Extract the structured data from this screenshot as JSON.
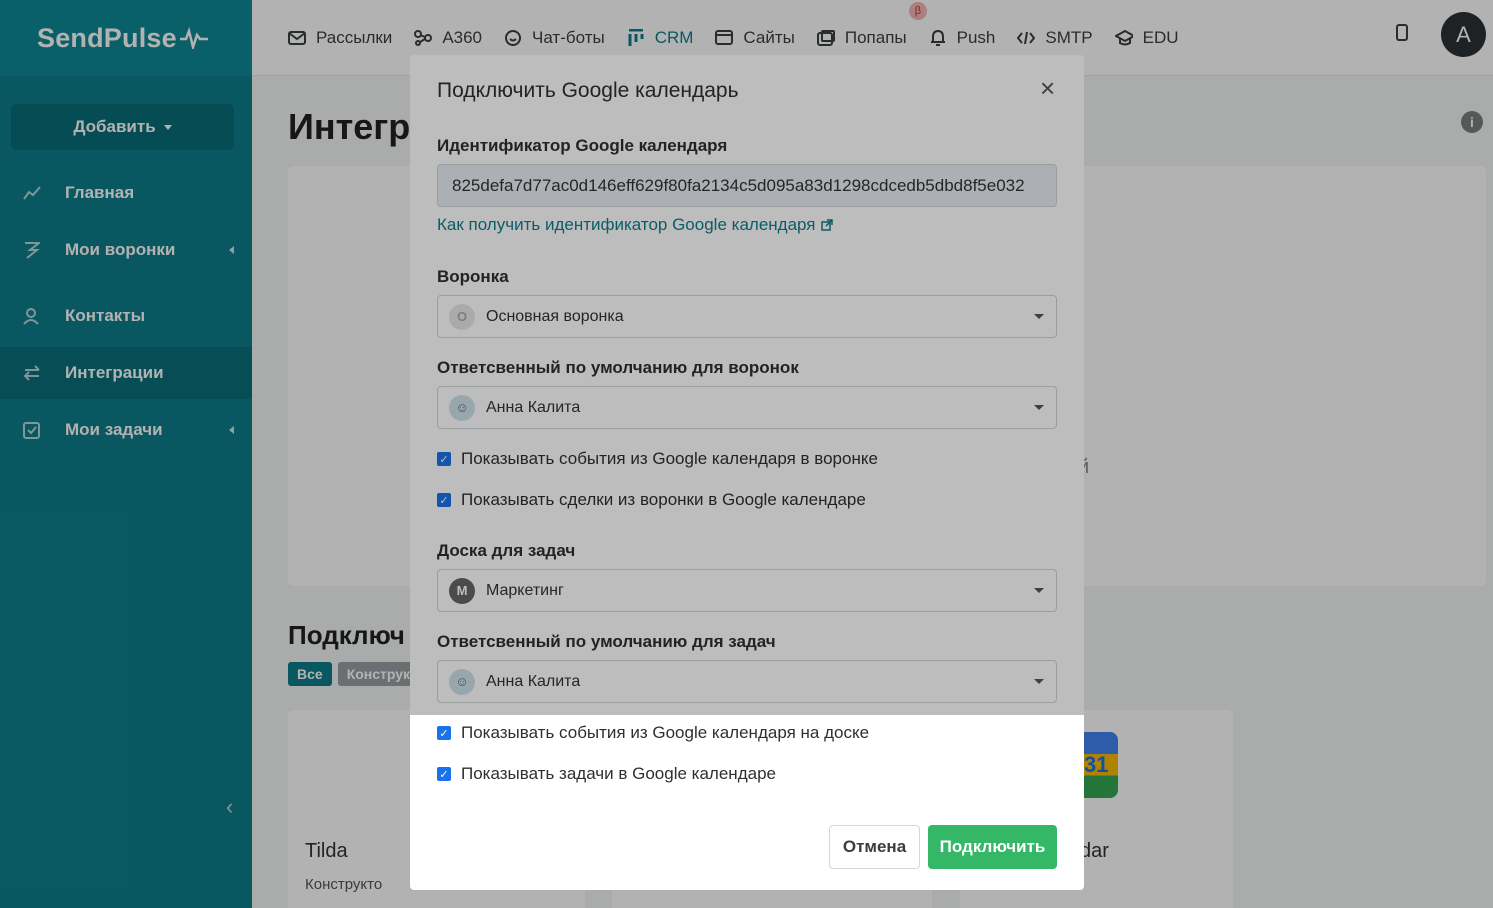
{
  "brand": {
    "logo_text": "SendPulse"
  },
  "sidebar": {
    "add_label": "Добавить",
    "items": [
      {
        "label": "Главная",
        "icon": "chart-line-icon"
      },
      {
        "label": "Мои воронки",
        "icon": "funnel-icon"
      },
      {
        "label": "Контакты",
        "icon": "contacts-icon"
      },
      {
        "label": "Интеграции",
        "icon": "arrows-exchange-icon"
      },
      {
        "label": "Мои задачи",
        "icon": "task-check-icon"
      }
    ]
  },
  "topnav": {
    "items": [
      {
        "label": "Рассылки",
        "icon": "mail-icon"
      },
      {
        "label": "A360",
        "icon": "automation-icon"
      },
      {
        "label": "Чат-боты",
        "icon": "chat-icon"
      },
      {
        "label": "CRM",
        "icon": "crm-icon"
      },
      {
        "label": "Сайты",
        "icon": "site-icon"
      },
      {
        "label": "Попапы",
        "icon": "popup-icon",
        "badge": "β"
      },
      {
        "label": "Push",
        "icon": "bell-icon"
      },
      {
        "label": "SMTP",
        "icon": "code-icon"
      },
      {
        "label": "EDU",
        "icon": "graduation-cap-icon"
      }
    ],
    "avatar_letter": "A"
  },
  "page": {
    "title": "Интегр",
    "section_title": "Подключ",
    "filters": [
      "Все",
      "Конструк"
    ],
    "bg_fragment": "й",
    "cards": [
      {
        "title": "Tilda",
        "sub": "Конструкто"
      },
      {
        "title": "dar"
      }
    ],
    "gcal_num": "31"
  },
  "modal": {
    "title": "Подключить Google календарь",
    "calendar_id_label": "Идентификатор Google календаря",
    "calendar_id_value": "825defa7d77ac0d146eff629f80fa2134c5d095a83d1298cdcedb5dbd8f5e032",
    "help_link": "Как получить идентификатор Google календаря",
    "funnel_label": "Воронка",
    "funnel_value": "Основная воронка",
    "funnel_badge": "O",
    "funnel_owner_label": "Ответсвенный по умолчанию для воронок",
    "funnel_owner_value": "Анна Калита",
    "check_events_funnel": "Показывать события из Google календаря в воронке",
    "check_deals_calendar": "Показывать сделки из воронки в Google календаре",
    "board_label": "Доска для задач",
    "board_value": "Маркетинг",
    "board_badge": "M",
    "task_owner_label": "Ответсвенный по умолчанию для задач",
    "task_owner_value": "Анна Калита",
    "check_events_board": "Показывать события из Google календаря на доске",
    "check_tasks_calendar": "Показывать задачи в Google календаре",
    "cancel_label": "Отмена",
    "connect_label": "Подключить"
  },
  "colors": {
    "primary": "#0e7e8b",
    "success": "#34b767",
    "checkbox": "#1a73e8"
  }
}
